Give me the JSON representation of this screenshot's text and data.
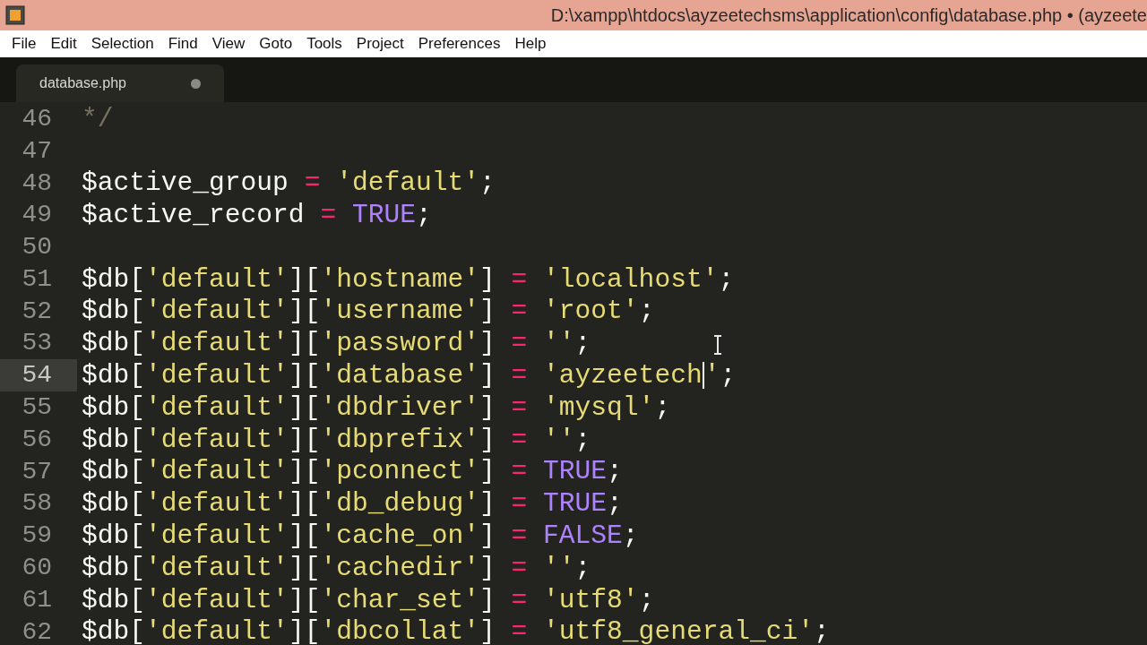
{
  "window": {
    "title": "D:\\xampp\\htdocs\\ayzeetechsms\\application\\config\\database.php • (ayzeete"
  },
  "menu": [
    "File",
    "Edit",
    "Selection",
    "Find",
    "View",
    "Goto",
    "Tools",
    "Project",
    "Preferences",
    "Help"
  ],
  "tabs": [
    {
      "label": "database.php",
      "selected": true,
      "modified": true
    }
  ],
  "lines": [
    {
      "number": "46",
      "current": false,
      "tokens": [
        {
          "kind": "comment",
          "text": "*/"
        }
      ]
    },
    {
      "number": "47",
      "current": false
    },
    {
      "number": "48",
      "current": false,
      "tokens": [
        {
          "kind": "var",
          "text": "$active_group"
        },
        {
          "kind": "op",
          "text": " = "
        },
        {
          "kind": "str",
          "text": "'default'"
        },
        {
          "kind": "plain",
          "text": ";"
        }
      ]
    },
    {
      "number": "49",
      "current": false,
      "tokens": [
        {
          "kind": "var",
          "text": "$active_record"
        },
        {
          "kind": "op",
          "text": " = "
        },
        {
          "kind": "const",
          "text": "TRUE"
        },
        {
          "kind": "plain",
          "text": ";"
        }
      ]
    },
    {
      "number": "50",
      "current": false
    },
    {
      "number": "51",
      "current": false,
      "tokens": [
        {
          "kind": "var",
          "text": "$db["
        },
        {
          "kind": "str",
          "text": "'default'"
        },
        {
          "kind": "plain",
          "text": "]["
        },
        {
          "kind": "str",
          "text": "'hostname'"
        },
        {
          "kind": "plain",
          "text": "]"
        },
        {
          "kind": "op",
          "text": " = "
        },
        {
          "kind": "str",
          "text": "'localhost'"
        },
        {
          "kind": "plain",
          "text": ";"
        }
      ]
    },
    {
      "number": "52",
      "current": false,
      "tokens": [
        {
          "kind": "var",
          "text": "$db["
        },
        {
          "kind": "str",
          "text": "'default'"
        },
        {
          "kind": "plain",
          "text": "]["
        },
        {
          "kind": "str",
          "text": "'username'"
        },
        {
          "kind": "plain",
          "text": "]"
        },
        {
          "kind": "op",
          "text": " = "
        },
        {
          "kind": "str",
          "text": "'root'"
        },
        {
          "kind": "plain",
          "text": ";"
        }
      ]
    },
    {
      "number": "53",
      "current": false,
      "tokens": [
        {
          "kind": "var",
          "text": "$db["
        },
        {
          "kind": "str",
          "text": "'default'"
        },
        {
          "kind": "plain",
          "text": "]["
        },
        {
          "kind": "str",
          "text": "'password'"
        },
        {
          "kind": "plain",
          "text": "]"
        },
        {
          "kind": "op",
          "text": " = "
        },
        {
          "kind": "str",
          "text": "''"
        },
        {
          "kind": "plain",
          "text": ";"
        }
      ]
    },
    {
      "number": "54",
      "current": true,
      "tokens": [
        {
          "kind": "var",
          "text": "$db["
        },
        {
          "kind": "str",
          "text": "'default'"
        },
        {
          "kind": "plain",
          "text": "]["
        },
        {
          "kind": "str",
          "text": "'database'"
        },
        {
          "kind": "plain",
          "text": "]"
        },
        {
          "kind": "op",
          "text": " = "
        },
        {
          "kind": "str",
          "text": "'ayzeetech"
        },
        {
          "kind": "caret"
        },
        {
          "kind": "str",
          "text": "'"
        },
        {
          "kind": "plain",
          "text": ";"
        }
      ]
    },
    {
      "number": "55",
      "current": false,
      "tokens": [
        {
          "kind": "var",
          "text": "$db["
        },
        {
          "kind": "str",
          "text": "'default'"
        },
        {
          "kind": "plain",
          "text": "]["
        },
        {
          "kind": "str",
          "text": "'dbdriver'"
        },
        {
          "kind": "plain",
          "text": "]"
        },
        {
          "kind": "op",
          "text": " = "
        },
        {
          "kind": "str",
          "text": "'mysql'"
        },
        {
          "kind": "plain",
          "text": ";"
        }
      ]
    },
    {
      "number": "56",
      "current": false,
      "tokens": [
        {
          "kind": "var",
          "text": "$db["
        },
        {
          "kind": "str",
          "text": "'default'"
        },
        {
          "kind": "plain",
          "text": "]["
        },
        {
          "kind": "str",
          "text": "'dbprefix'"
        },
        {
          "kind": "plain",
          "text": "]"
        },
        {
          "kind": "op",
          "text": " = "
        },
        {
          "kind": "str",
          "text": "''"
        },
        {
          "kind": "plain",
          "text": ";"
        }
      ]
    },
    {
      "number": "57",
      "current": false,
      "tokens": [
        {
          "kind": "var",
          "text": "$db["
        },
        {
          "kind": "str",
          "text": "'default'"
        },
        {
          "kind": "plain",
          "text": "]["
        },
        {
          "kind": "str",
          "text": "'pconnect'"
        },
        {
          "kind": "plain",
          "text": "]"
        },
        {
          "kind": "op",
          "text": " = "
        },
        {
          "kind": "const",
          "text": "TRUE"
        },
        {
          "kind": "plain",
          "text": ";"
        }
      ]
    },
    {
      "number": "58",
      "current": false,
      "tokens": [
        {
          "kind": "var",
          "text": "$db["
        },
        {
          "kind": "str",
          "text": "'default'"
        },
        {
          "kind": "plain",
          "text": "]["
        },
        {
          "kind": "str",
          "text": "'db_debug'"
        },
        {
          "kind": "plain",
          "text": "]"
        },
        {
          "kind": "op",
          "text": " = "
        },
        {
          "kind": "const",
          "text": "TRUE"
        },
        {
          "kind": "plain",
          "text": ";"
        }
      ]
    },
    {
      "number": "59",
      "current": false,
      "tokens": [
        {
          "kind": "var",
          "text": "$db["
        },
        {
          "kind": "str",
          "text": "'default'"
        },
        {
          "kind": "plain",
          "text": "]["
        },
        {
          "kind": "str",
          "text": "'cache_on'"
        },
        {
          "kind": "plain",
          "text": "]"
        },
        {
          "kind": "op",
          "text": " = "
        },
        {
          "kind": "const",
          "text": "FALSE"
        },
        {
          "kind": "plain",
          "text": ";"
        }
      ]
    },
    {
      "number": "60",
      "current": false,
      "tokens": [
        {
          "kind": "var",
          "text": "$db["
        },
        {
          "kind": "str",
          "text": "'default'"
        },
        {
          "kind": "plain",
          "text": "]["
        },
        {
          "kind": "str",
          "text": "'cachedir'"
        },
        {
          "kind": "plain",
          "text": "]"
        },
        {
          "kind": "op",
          "text": " = "
        },
        {
          "kind": "str",
          "text": "''"
        },
        {
          "kind": "plain",
          "text": ";"
        }
      ]
    },
    {
      "number": "61",
      "current": false,
      "tokens": [
        {
          "kind": "var",
          "text": "$db["
        },
        {
          "kind": "str",
          "text": "'default'"
        },
        {
          "kind": "plain",
          "text": "]["
        },
        {
          "kind": "str",
          "text": "'char_set'"
        },
        {
          "kind": "plain",
          "text": "]"
        },
        {
          "kind": "op",
          "text": " = "
        },
        {
          "kind": "str",
          "text": "'utf8'"
        },
        {
          "kind": "plain",
          "text": ";"
        }
      ]
    },
    {
      "number": "62",
      "current": false,
      "tokens": [
        {
          "kind": "var",
          "text": "$db["
        },
        {
          "kind": "str",
          "text": "'default'"
        },
        {
          "kind": "plain",
          "text": "]["
        },
        {
          "kind": "str",
          "text": "'dbcollat'"
        },
        {
          "kind": "plain",
          "text": "]"
        },
        {
          "kind": "op",
          "text": " = "
        },
        {
          "kind": "str",
          "text": "'utf8_general_ci'"
        },
        {
          "kind": "plain",
          "text": ";"
        }
      ]
    }
  ]
}
